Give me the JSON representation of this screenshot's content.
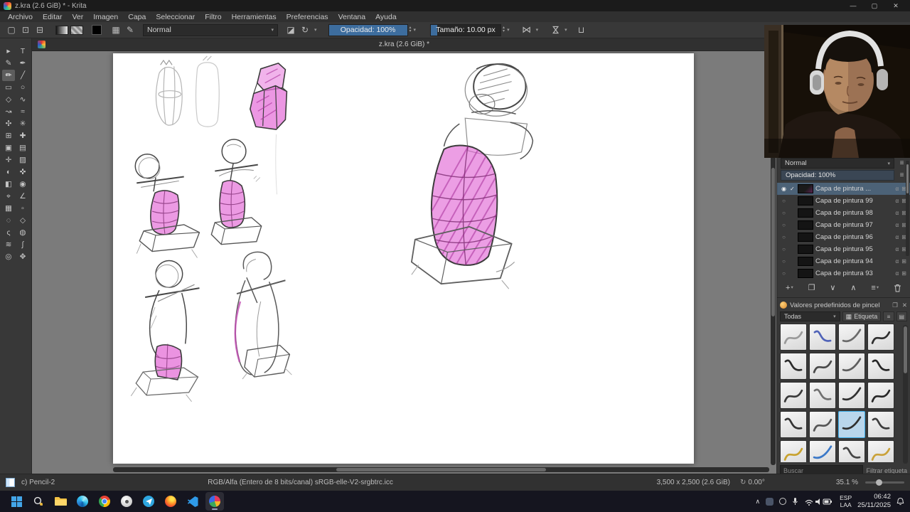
{
  "window": {
    "title": "z.kra (2.6 GiB) * - Krita",
    "controls": {
      "min": "—",
      "max": "▢",
      "close": "✕"
    }
  },
  "menubar": {
    "items": [
      "Archivo",
      "Editar",
      "Ver",
      "Imagen",
      "Capa",
      "Seleccionar",
      "Filtro",
      "Herramientas",
      "Preferencias",
      "Ventana",
      "Ayuda"
    ]
  },
  "toolbar": {
    "blend_mode": "Normal",
    "opacity": "Opacidad: 100%",
    "size": "Tamaño: 10.00 px",
    "icons": {
      "new": "▢",
      "open": "⊡",
      "save": "⊟",
      "workspace": "▦",
      "brush_editor": "✎",
      "eraser": "◪",
      "reload": "↻",
      "mirror": "⋈",
      "trim": "⊔"
    }
  },
  "ui": {
    "caret": "▾",
    "spin_up": "▴",
    "spin_down": "▾",
    "hamburger": "≡"
  },
  "canvas": {
    "tab_title": "z.kra (2.6 GiB) *"
  },
  "tools": [
    {
      "glyph": "▸",
      "name": "select-shapes-tool"
    },
    {
      "glyph": "T",
      "name": "text-tool"
    },
    {
      "glyph": "✎",
      "name": "edit-shapes-tool"
    },
    {
      "glyph": "✒",
      "name": "calligraphy-tool"
    },
    {
      "glyph": "✏",
      "name": "freehand-brush-tool",
      "state": "selected"
    },
    {
      "glyph": "╱",
      "name": "line-tool"
    },
    {
      "glyph": "▭",
      "name": "rectangle-tool"
    },
    {
      "glyph": "○",
      "name": "ellipse-tool"
    },
    {
      "glyph": "◇",
      "name": "polygon-tool"
    },
    {
      "glyph": "∿",
      "name": "polyline-tool"
    },
    {
      "glyph": "↝",
      "name": "bezier-curve-tool"
    },
    {
      "glyph": "≈",
      "name": "freehand-path-tool"
    },
    {
      "glyph": "✣",
      "name": "dynamic-brush-tool"
    },
    {
      "glyph": "✳",
      "name": "multibrush-tool"
    },
    {
      "glyph": "⊞",
      "name": "transform-tool"
    },
    {
      "glyph": "✚",
      "name": "move-tool"
    },
    {
      "glyph": "▣",
      "name": "crop-tool"
    },
    {
      "glyph": "▤",
      "name": "gradient-tool"
    },
    {
      "glyph": "✛",
      "name": "color-sampler-tool"
    },
    {
      "glyph": "▨",
      "name": "pattern-tool"
    },
    {
      "glyph": "◐",
      "name": "colorize-mask-tool"
    },
    {
      "glyph": "✜",
      "name": "smart-patch-tool"
    },
    {
      "glyph": "◧",
      "name": "fill-tool"
    },
    {
      "glyph": "◉",
      "name": "enclose-fill-tool"
    },
    {
      "glyph": "⌖",
      "name": "assistants-tool"
    },
    {
      "glyph": "∠",
      "name": "measure-tool"
    },
    {
      "glyph": "▦",
      "name": "reference-images-tool"
    },
    {
      "glyph": "▫",
      "name": "rect-select-tool"
    },
    {
      "glyph": "◌",
      "name": "ellipse-select-tool"
    },
    {
      "glyph": "◇",
      "name": "polygon-select-tool"
    },
    {
      "glyph": "ς",
      "name": "freehand-select-tool"
    },
    {
      "glyph": "◍",
      "name": "contiguous-select-tool"
    },
    {
      "glyph": "≋",
      "name": "similar-select-tool"
    },
    {
      "glyph": "∫",
      "name": "bezier-select-tool"
    },
    {
      "glyph": "◎",
      "name": "zoom-tool"
    },
    {
      "glyph": "✥",
      "name": "pan-tool"
    }
  ],
  "layers_docker": {
    "blend_mode": "Normal",
    "opacity_label": "Opacidad:  100%",
    "row_icons": "α ⊞",
    "rows": [
      {
        "name": "Capa de pintura ...",
        "vis": "◉",
        "check": "✓",
        "state": "selected"
      },
      {
        "name": "Capa de pintura 99",
        "vis": "○",
        "check": ""
      },
      {
        "name": "Capa de pintura 98",
        "vis": "○",
        "check": ""
      },
      {
        "name": "Capa de pintura 97",
        "vis": "○",
        "check": ""
      },
      {
        "name": "Capa de pintura 96",
        "vis": "○",
        "check": ""
      },
      {
        "name": "Capa de pintura 95",
        "vis": "○",
        "check": ""
      },
      {
        "name": "Capa de pintura 94",
        "vis": "○",
        "check": ""
      },
      {
        "name": "Capa de pintura 93",
        "vis": "○",
        "check": ""
      }
    ],
    "buttons": {
      "add": "+",
      "duplicate": "❐",
      "down": "∨",
      "up": "∧",
      "properties": "≡"
    }
  },
  "brush_docker": {
    "title": "Valores predefinidos de pincel",
    "filter_all": "Todas",
    "tag_button": "Etiqueta",
    "search_placeholder": "Buscar",
    "filter_tag": "Filtrar etiqueta",
    "icons": {
      "float": "❐",
      "close": "✕",
      "tag": "▦",
      "list": "≡",
      "view": "▤"
    },
    "presets": [
      {
        "stroke": "#9a9a9a",
        "variant": "v1"
      },
      {
        "stroke": "#5063b8",
        "variant": "v2"
      },
      {
        "stroke": "#6a6a6a",
        "variant": "v3"
      },
      {
        "stroke": "#2e2e2e",
        "variant": "v1"
      },
      {
        "stroke": "#2b2b2b",
        "variant": "v2"
      },
      {
        "stroke": "#4a4a4a",
        "variant": "v1"
      },
      {
        "stroke": "#5e5e5e",
        "variant": "v3"
      },
      {
        "stroke": "#262626",
        "variant": "v2"
      },
      {
        "stroke": "#3a3a3a",
        "variant": "v1"
      },
      {
        "stroke": "#707070",
        "variant": "v2"
      },
      {
        "stroke": "#303030",
        "variant": "v3"
      },
      {
        "stroke": "#282828",
        "variant": "v1"
      },
      {
        "stroke": "#333333",
        "variant": "v2"
      },
      {
        "stroke": "#565656",
        "variant": "v1"
      },
      {
        "stroke": "#2f2f2f",
        "variant": "v3",
        "state": "sel"
      },
      {
        "stroke": "#3c3c3c",
        "variant": "v2"
      },
      {
        "stroke": "#c8a22e",
        "variant": "v1"
      },
      {
        "stroke": "#3a78c8",
        "variant": "v3"
      },
      {
        "stroke": "#454545",
        "variant": "v2"
      },
      {
        "stroke": "#caa23a",
        "variant": "v1"
      },
      {
        "stroke": "#333333",
        "variant": "v3"
      },
      {
        "stroke": "#585858",
        "variant": "v1"
      },
      {
        "stroke": "#3a3a3a",
        "variant": "v2"
      },
      {
        "stroke": "#6a6a6a",
        "variant": "v3"
      }
    ]
  },
  "statusbar": {
    "brush": "c) Pencil-2",
    "profile": "RGB/Alfa (Entero de 8 bits/canal)  sRGB-elle-V2-srgbtrc.icc",
    "dimensions": "3,500 x 2,500 (2.6 GiB)",
    "angle_icon": "↻",
    "angle": "0.00°",
    "zoom": "35.1 %"
  },
  "taskbar": {
    "lang_top": "ESP",
    "lang_bottom": "LAA",
    "time": "06:42",
    "date": "25/11/2025",
    "chevron": "∧"
  },
  "colors": {
    "accent_blue": "#3d6d9e",
    "selection_blue": "#4c6277",
    "sketch_pink": "#e46fd7"
  }
}
